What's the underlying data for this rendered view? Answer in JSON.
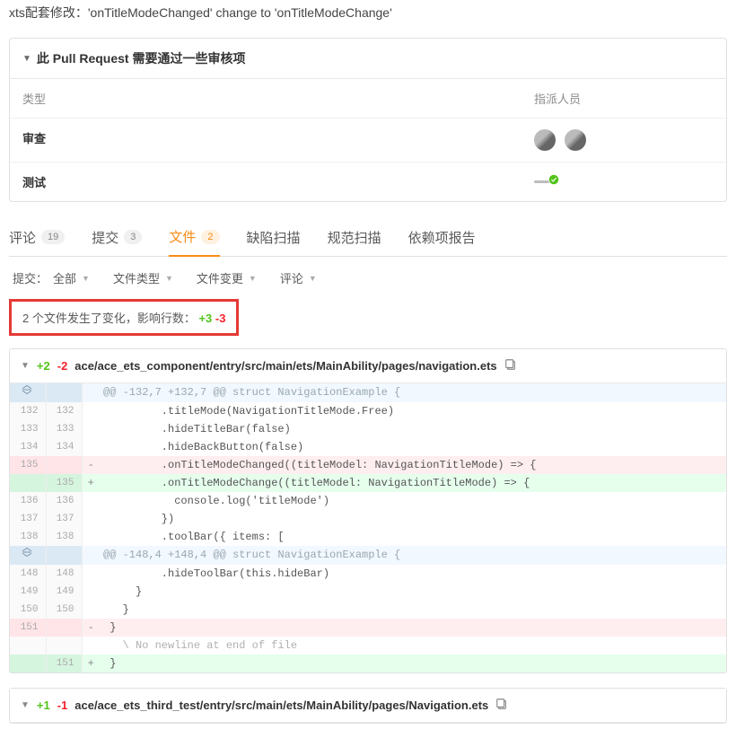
{
  "description": "xts配套修改：'onTitleModeChanged' change to 'onTitleModeChange'",
  "checksPanel": {
    "title": "此 Pull Request 需要通过一些审核项",
    "headerType": "类型",
    "headerAssignee": "指派人员",
    "rows": {
      "review": "审查",
      "test": "测试"
    }
  },
  "tabs": {
    "comments": {
      "label": "评论",
      "count": "19"
    },
    "commits": {
      "label": "提交",
      "count": "3"
    },
    "files": {
      "label": "文件",
      "count": "2"
    },
    "defectScan": {
      "label": "缺陷扫描"
    },
    "specScan": {
      "label": "规范扫描"
    },
    "depReport": {
      "label": "依赖项报告"
    }
  },
  "filters": {
    "commitLabel": "提交：",
    "commitValue": "全部",
    "fileType": "文件类型",
    "fileChange": "文件变更",
    "comments": "评论"
  },
  "summary": {
    "text": "2 个文件发生了变化，影响行数：",
    "add": "+3",
    "del": "-3"
  },
  "files": [
    {
      "add": "+2",
      "del": "-2",
      "path": "ace/ace_ets_component/entry/src/main/ets/MainAbility/pages/navigation.ets",
      "diff": [
        {
          "type": "hunk",
          "old": "",
          "new": "",
          "sign": "",
          "code": "@@ -132,7 +132,7 @@ struct NavigationExample {"
        },
        {
          "type": "ctx",
          "old": "132",
          "new": "132",
          "sign": "",
          "code": "         .titleMode(NavigationTitleMode.Free)"
        },
        {
          "type": "ctx",
          "old": "133",
          "new": "133",
          "sign": "",
          "code": "         .hideTitleBar(false)"
        },
        {
          "type": "ctx",
          "old": "134",
          "new": "134",
          "sign": "",
          "code": "         .hideBackButton(false)"
        },
        {
          "type": "del",
          "old": "135",
          "new": "",
          "sign": "-",
          "code": "         .onTitleModeChanged((titleModel: NavigationTitleMode) => {"
        },
        {
          "type": "add",
          "old": "",
          "new": "135",
          "sign": "+",
          "code": "         .onTitleModeChange((titleModel: NavigationTitleMode) => {"
        },
        {
          "type": "ctx",
          "old": "136",
          "new": "136",
          "sign": "",
          "code": "           console.log('titleMode')"
        },
        {
          "type": "ctx",
          "old": "137",
          "new": "137",
          "sign": "",
          "code": "         })"
        },
        {
          "type": "ctx",
          "old": "138",
          "new": "138",
          "sign": "",
          "code": "         .toolBar({ items: ["
        },
        {
          "type": "hunk",
          "old": "",
          "new": "",
          "sign": "",
          "code": "@@ -148,4 +148,4 @@ struct NavigationExample {"
        },
        {
          "type": "ctx",
          "old": "148",
          "new": "148",
          "sign": "",
          "code": "         .hideToolBar(this.hideBar)"
        },
        {
          "type": "ctx",
          "old": "149",
          "new": "149",
          "sign": "",
          "code": "     }"
        },
        {
          "type": "ctx",
          "old": "150",
          "new": "150",
          "sign": "",
          "code": "   }"
        },
        {
          "type": "del",
          "old": "151",
          "new": "",
          "sign": "-",
          "code": " }"
        },
        {
          "type": "meta",
          "old": "",
          "new": "",
          "sign": "",
          "code": "   \\ No newline at end of file"
        },
        {
          "type": "add",
          "old": "",
          "new": "151",
          "sign": "+",
          "code": " }"
        }
      ]
    },
    {
      "add": "+1",
      "del": "-1",
      "path": "ace/ace_ets_third_test/entry/src/main/ets/MainAbility/pages/Navigation.ets"
    }
  ]
}
